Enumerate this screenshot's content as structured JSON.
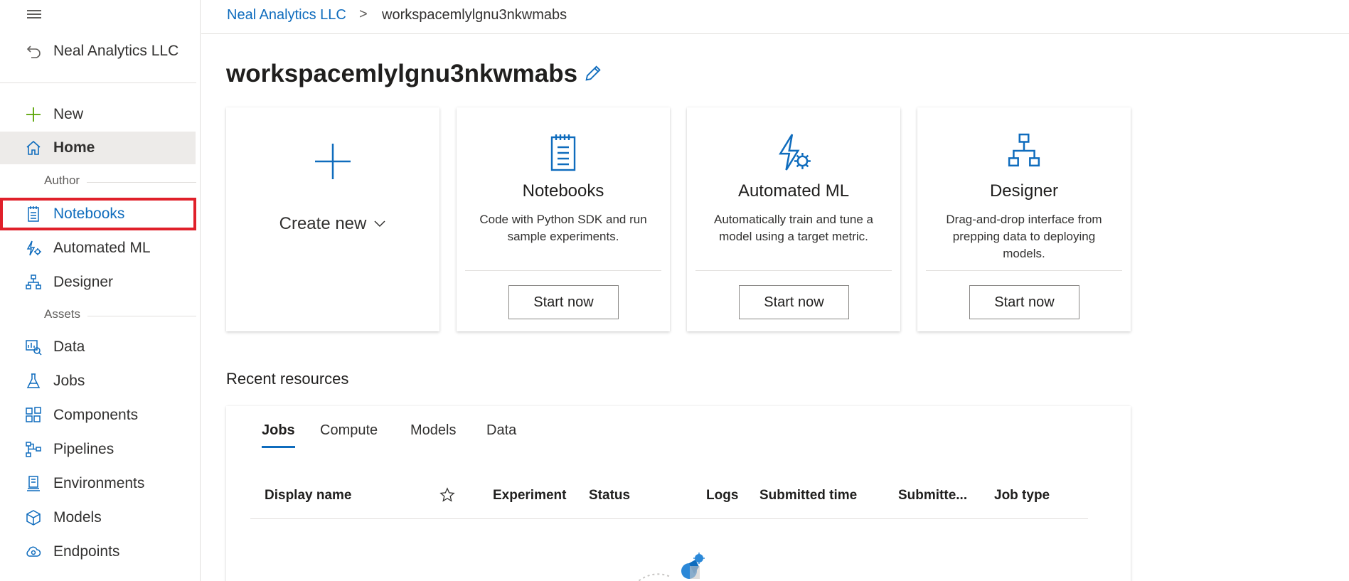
{
  "sidebar": {
    "org_name": "Neal Analytics LLC",
    "top_items": [
      {
        "label": "New",
        "icon": "plus-icon"
      },
      {
        "label": "Home",
        "icon": "home-icon"
      }
    ],
    "sections": [
      {
        "title": "Author",
        "items": [
          {
            "label": "Notebooks",
            "icon": "notebook-icon"
          },
          {
            "label": "Automated ML",
            "icon": "automated-ml-icon"
          },
          {
            "label": "Designer",
            "icon": "designer-icon"
          }
        ]
      },
      {
        "title": "Assets",
        "items": [
          {
            "label": "Data",
            "icon": "data-icon"
          },
          {
            "label": "Jobs",
            "icon": "flask-icon"
          },
          {
            "label": "Components",
            "icon": "components-icon"
          },
          {
            "label": "Pipelines",
            "icon": "pipelines-icon"
          },
          {
            "label": "Environments",
            "icon": "environments-icon"
          },
          {
            "label": "Models",
            "icon": "cube-icon"
          },
          {
            "label": "Endpoints",
            "icon": "cloud-icon"
          }
        ]
      }
    ]
  },
  "breadcrumb": {
    "org": "Neal Analytics LLC",
    "separator": ">",
    "current": "workspacemlylgnu3nkwmabs"
  },
  "page": {
    "title": "workspacemlylgnu3nkwmabs"
  },
  "cards": {
    "create": {
      "label": "Create new"
    },
    "notebooks": {
      "title": "Notebooks",
      "desc": "Code with Python SDK and run sample experiments.",
      "button": "Start now"
    },
    "automl": {
      "title": "Automated ML",
      "desc": "Automatically train and tune a model using a target metric.",
      "button": "Start now"
    },
    "designer": {
      "title": "Designer",
      "desc": "Drag-and-drop interface from prepping data to deploying models.",
      "button": "Start now"
    }
  },
  "recent": {
    "title": "Recent resources",
    "tabs": [
      "Jobs",
      "Compute",
      "Models",
      "Data"
    ],
    "active_tab": "Jobs",
    "columns": [
      "Display name",
      "Experiment",
      "Status",
      "Logs",
      "Submitted time",
      "Submitte...",
      "Job type"
    ]
  },
  "colors": {
    "accent": "#0f6cbd",
    "highlight": "#e0202a",
    "new_plus": "#57a300"
  }
}
